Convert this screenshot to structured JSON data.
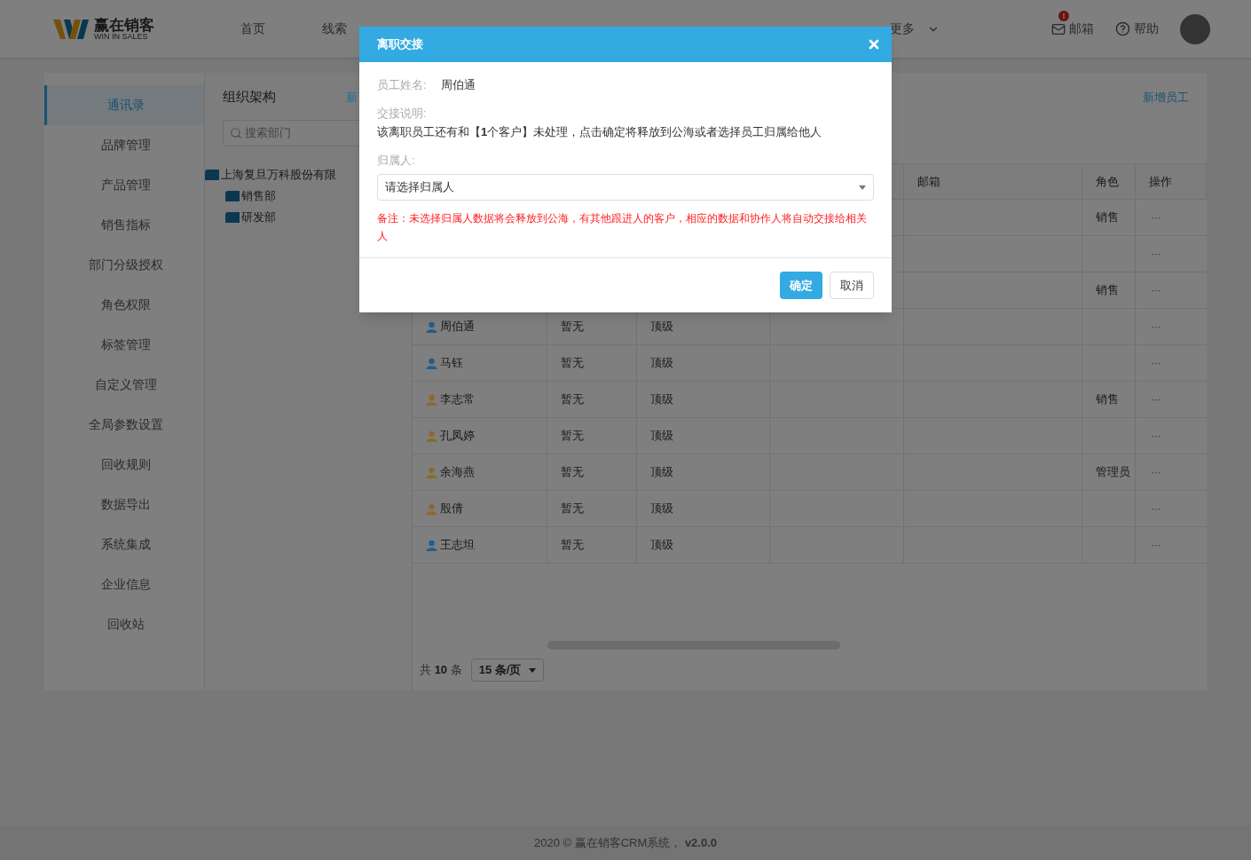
{
  "header": {
    "logo_name": "赢在销客",
    "logo_tagline": "WIN IN SALES",
    "nav": [
      {
        "label": "首页",
        "selected": false
      },
      {
        "label": "线索",
        "selected": false
      }
    ],
    "more": "更多",
    "mail": "邮箱",
    "mail_badge": "!",
    "help": "帮助"
  },
  "sidebar": {
    "items": [
      {
        "label": "通讯录",
        "selected": true
      },
      {
        "label": "品牌管理",
        "selected": false
      },
      {
        "label": "产品管理",
        "selected": false
      },
      {
        "label": "销售指标",
        "selected": false
      },
      {
        "label": "部门分级授权",
        "selected": false
      },
      {
        "label": "角色权限",
        "selected": false
      },
      {
        "label": "标签管理",
        "selected": false
      },
      {
        "label": "自定义管理",
        "selected": false
      },
      {
        "label": "全局参数设置",
        "selected": false
      },
      {
        "label": "回收规则",
        "selected": false
      },
      {
        "label": "数据导出",
        "selected": false
      },
      {
        "label": "系统集成",
        "selected": false
      },
      {
        "label": "企业信息",
        "selected": false
      },
      {
        "label": "回收站",
        "selected": false
      }
    ]
  },
  "org": {
    "title": "组织架构",
    "add_link": "新",
    "search_placeholder": "搜索部门",
    "tree": [
      {
        "label": "上海复旦万科股份有限",
        "children": [
          {
            "label": "销售部"
          },
          {
            "label": "研发部"
          }
        ]
      }
    ]
  },
  "table": {
    "add_employee": "新增员工",
    "headers": {
      "email": "邮箱",
      "role": "角色",
      "action": "操作"
    },
    "rows": [
      {
        "role": "销售",
        "action": "···"
      },
      {
        "action": "···"
      },
      {
        "role": "销售",
        "action": "···"
      },
      {
        "name": "周伯通",
        "color": "#1f5f8f",
        "department": "暂无",
        "level_text": "顶级",
        "action": "···"
      },
      {
        "name": "马钰",
        "color": "#1f5f8f",
        "department": "暂无",
        "level_text": "顶级",
        "action": "···"
      },
      {
        "name": "李志常",
        "color": "#8a6a2a",
        "department": "暂无",
        "level_text": "顶级",
        "role": "销售",
        "action": "···"
      },
      {
        "name": "孔凤婷",
        "color": "#8a6a2a",
        "department": "暂无",
        "level_text": "顶级",
        "action": "···"
      },
      {
        "name": "余海燕",
        "color": "#8a6a2a",
        "department": "暂无",
        "level_text": "顶级",
        "role": "管理员",
        "action": "···"
      },
      {
        "name": "殷倩",
        "color": "#8a6a2a",
        "department": "暂无",
        "level_text": "顶级",
        "action": "···"
      },
      {
        "name": "王志坦",
        "color": "#1f5f8f",
        "department": "暂无",
        "level_text": "顶级",
        "action": "···"
      }
    ],
    "pagination": {
      "prefix": "共",
      "total": "10",
      "suffix": "条",
      "page_size": "15 条/页"
    }
  },
  "footer": {
    "text": "2020 © 赢在销客CRM系统，",
    "version": "v2.0.0"
  },
  "modal": {
    "title": "离职交接",
    "employee_label": "员工姓名:",
    "employee_name": "周伯通",
    "note_label": "交接说明:",
    "note": "该离职员工还有和【**1**个客户】未处理，点击确定将释放到公海或者选择员工归属给他人",
    "owner_label": "归属人:",
    "owner_placeholder": "请选择归属人",
    "warning": "备注：未选择归属人数据将会释放到公海，有其他跟进人的客户，相应的数据和协作人将自动交接给相关人",
    "confirm": "确定",
    "cancel": "取消"
  }
}
